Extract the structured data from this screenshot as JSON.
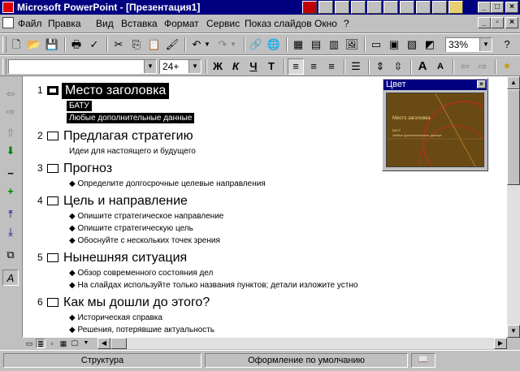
{
  "window": {
    "title": "Microsoft PowerPoint - [Презентация1]"
  },
  "menu": {
    "items": [
      "Файл",
      "Правка",
      "Вид",
      "Вставка",
      "Формат",
      "Сервис",
      "Показ слайдов",
      "Окно",
      "?"
    ]
  },
  "toolbar": {
    "zoom": "33%",
    "font_name": "",
    "font_size": "24+",
    "bold": "Ж",
    "italic": "К",
    "underline": "Ч",
    "shadow": "Т"
  },
  "outline": {
    "slides": [
      {
        "number": "1",
        "title": "Место заголовка",
        "selected": true,
        "subtitles": [
          "БАТУ",
          "Любые дополнительные данные"
        ]
      },
      {
        "number": "2",
        "title": "Предлагая стратегию",
        "plain": [
          "Идеи для настоящего и будущего"
        ]
      },
      {
        "number": "3",
        "title": "Прогноз",
        "bullets": [
          "Определите долгосрочные целевые направления"
        ]
      },
      {
        "number": "4",
        "title": "Цель и направление",
        "bullets": [
          "Опишите стратегическое направление",
          "Опишите стратегическую цель",
          "Обоснуйте с нескольких точек зрения"
        ]
      },
      {
        "number": "5",
        "title": "Нынешняя ситуация",
        "bullets": [
          "Обзор современного состояния дел",
          "На слайдах используйте только названия пунктов; детали изложите устно"
        ]
      },
      {
        "number": "6",
        "title": "Как мы дошли до этого?",
        "bullets": [
          "Историческая справка",
          "Решения, потерявшие актуальность"
        ]
      }
    ]
  },
  "preview": {
    "title": "Цвет",
    "slide_title": "Место заголовка",
    "slide_sub1": "БАТУ",
    "slide_sub2": "Любые дополнительные данные",
    "background_color": "#6a4a14"
  },
  "status": {
    "view": "Структура",
    "design": "Оформление по умолчанию"
  },
  "colors": {
    "titlebar": "#000080",
    "face": "#c0c0c0"
  }
}
